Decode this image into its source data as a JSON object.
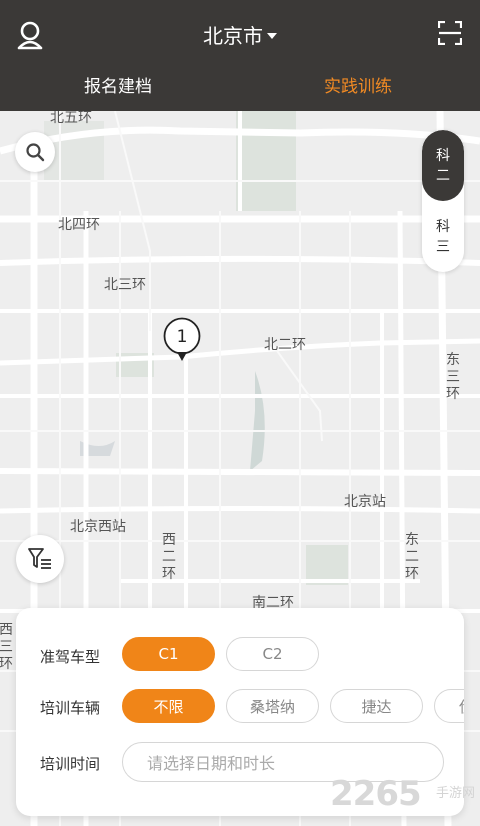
{
  "header": {
    "city": "北京市",
    "tabs": [
      {
        "label": "报名建档",
        "active": false
      },
      {
        "label": "实践训练",
        "active": true
      }
    ]
  },
  "map": {
    "road_labels": [
      "北五环",
      "北四环",
      "北三环",
      "北二环",
      "北京站",
      "北京西站",
      "南二环"
    ],
    "vertical_labels": [
      "东三环",
      "西二环",
      "东二环",
      "西三环"
    ],
    "pin_count": "1",
    "subject_switch": {
      "options": [
        {
          "label": "科二",
          "active": true
        },
        {
          "label": "科三",
          "active": false
        }
      ]
    }
  },
  "panel": {
    "license_type": {
      "label": "准驾车型",
      "options": [
        {
          "label": "C1",
          "active": true
        },
        {
          "label": "C2",
          "active": false
        }
      ]
    },
    "vehicle": {
      "label": "培训车辆",
      "options": [
        {
          "label": "不限",
          "active": true
        },
        {
          "label": "桑塔纳",
          "active": false
        },
        {
          "label": "捷达",
          "active": false
        },
        {
          "label": "伊",
          "active": false
        }
      ]
    },
    "time": {
      "label": "培训时间",
      "placeholder": "请选择日期和时长"
    }
  },
  "colors": {
    "header_bg": "#3b3937",
    "accent": "#f08518"
  },
  "watermark": {
    "text": "2265",
    "sub": "手游网"
  }
}
